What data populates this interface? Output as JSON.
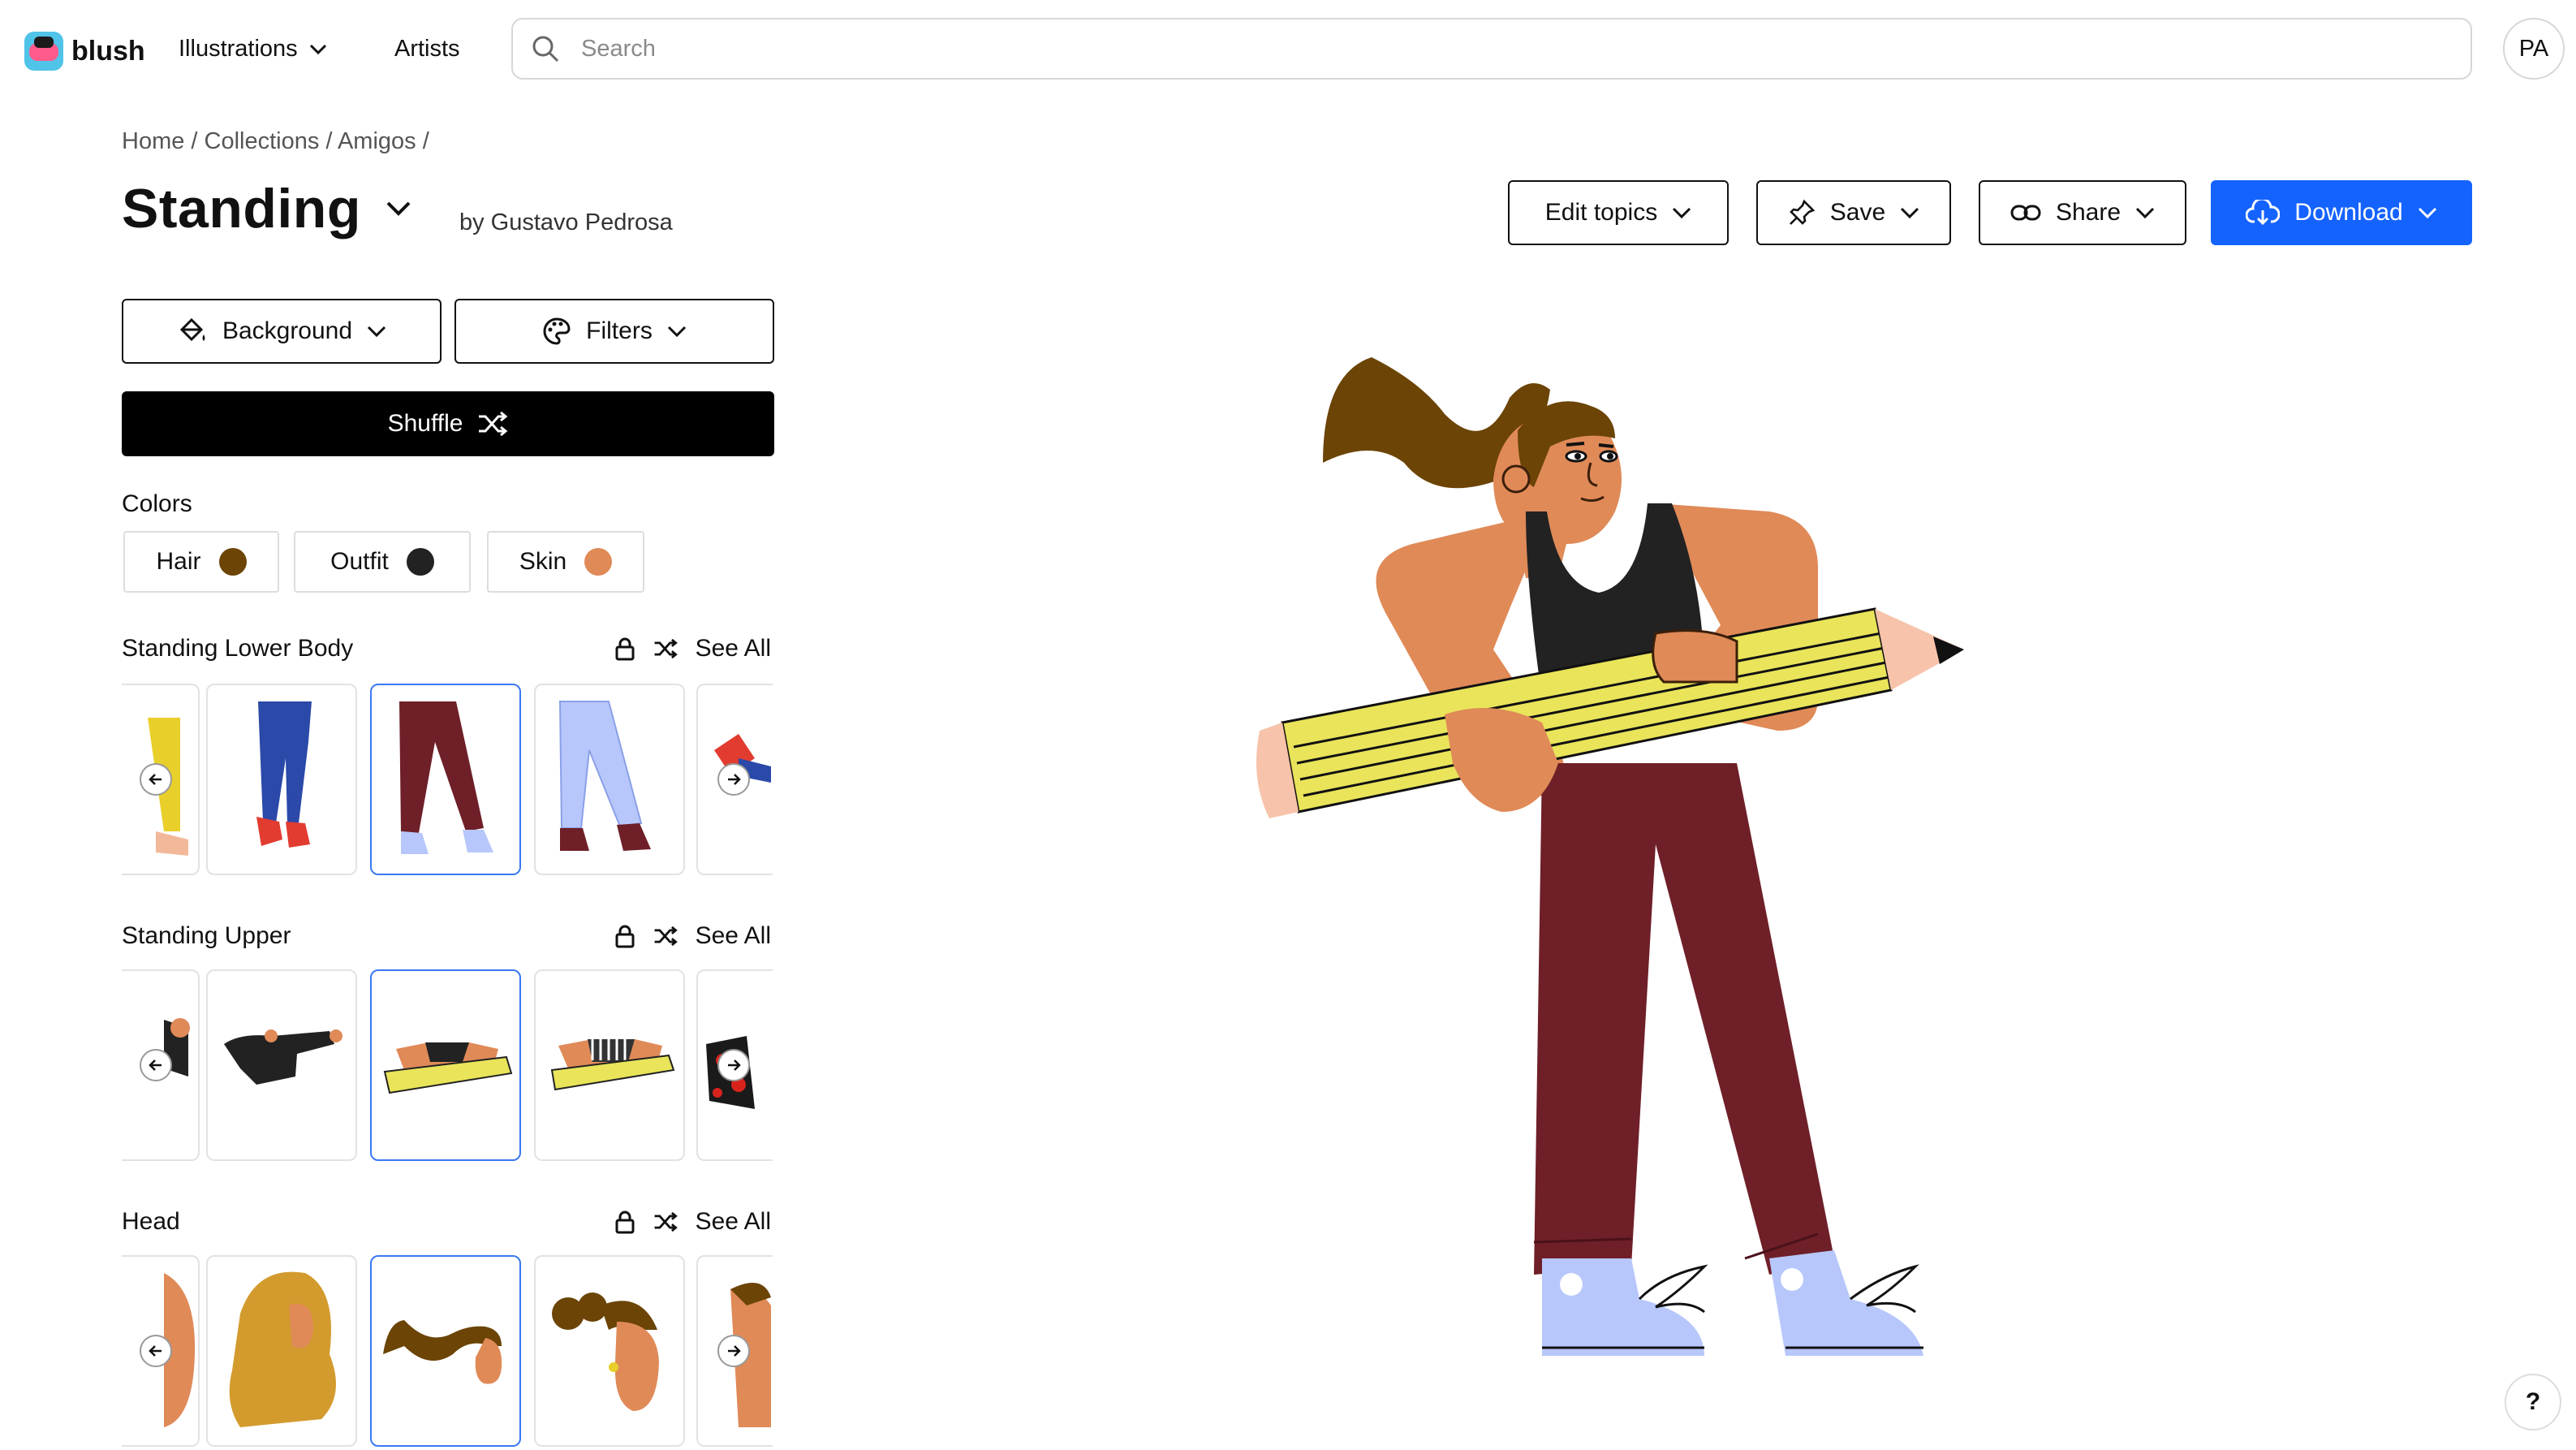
{
  "brand": {
    "name": "blush"
  },
  "nav": {
    "illustrations_label": "Illustrations",
    "artists_label": "Artists",
    "search_placeholder": "Search",
    "avatar_initials": "PA"
  },
  "breadcrumb": "Home / Collections / Amigos /",
  "page": {
    "title": "Standing",
    "author": "by Gustavo Pedrosa"
  },
  "actions": {
    "edit_topics": "Edit topics",
    "save": "Save",
    "share": "Share",
    "download": "Download"
  },
  "controls": {
    "background": "Background",
    "filters": "Filters",
    "shuffle": "Shuffle"
  },
  "colors": {
    "label": "Colors",
    "items": [
      {
        "label": "Hair",
        "color": "#6b4406"
      },
      {
        "label": "Outfit",
        "color": "#222222"
      },
      {
        "label": "Skin",
        "color": "#e08a58"
      }
    ]
  },
  "sections": [
    {
      "title": "Standing Lower Body",
      "see_all": "See All"
    },
    {
      "title": "Standing Upper",
      "see_all": "See All"
    },
    {
      "title": "Head",
      "see_all": "See All"
    }
  ],
  "palette": {
    "accent": "#1463ff",
    "hair": "#6b4406",
    "skin": "#e08a58",
    "pants": "#6f1f28",
    "top": "#222222",
    "pencil": "#e9e45a",
    "shoe": "#b7c7fb"
  },
  "help_label": "?"
}
